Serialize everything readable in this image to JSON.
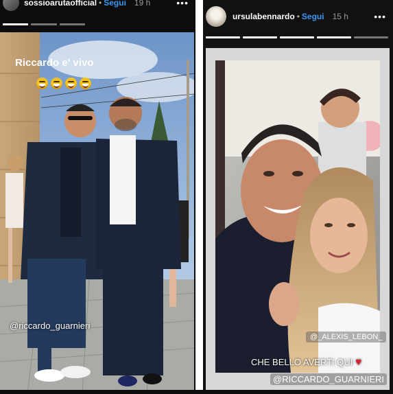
{
  "left_story": {
    "username": "sossioarutaofficial",
    "follow_label": "Segui",
    "time": "19 h",
    "more_icon": "more-dots-icon",
    "overlay_text": "Riccardo e' vivo",
    "emoji_count": 4,
    "mention": "@riccardo_guarnieri"
  },
  "right_story": {
    "username": "ursulabennardo",
    "follow_label": "Segui",
    "time": "15 h",
    "more_icon": "more-dots-icon",
    "tag_small": "@_ALEXIS_LEBON_",
    "caption": "CHE BELLO AVERTI QUI",
    "heart_icon": "heart-icon",
    "mention": "@RICCARDO_GUARNIERI"
  },
  "colors": {
    "follow": "#3897f0",
    "heart": "#e0202e"
  }
}
